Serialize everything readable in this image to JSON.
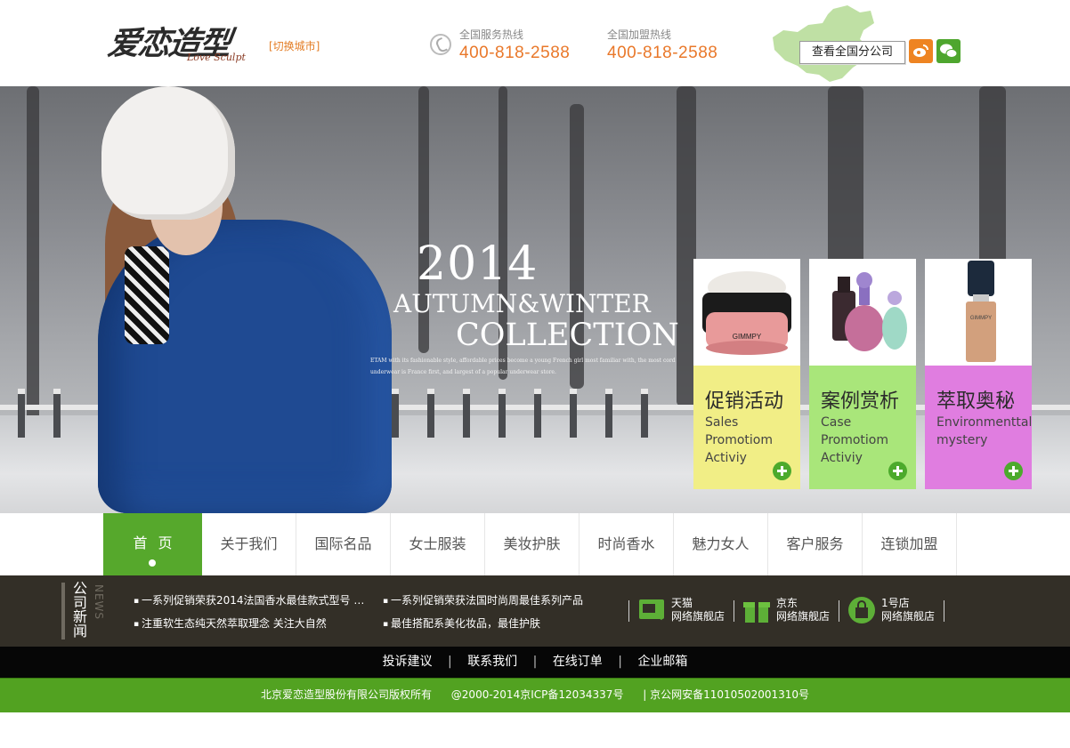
{
  "header": {
    "logo_cn": "爱恋造型",
    "logo_en": "Love Sculpt",
    "switch_city": "[切换城市]",
    "service_hotline": {
      "label": "全国服务热线",
      "number": "400-818-2588"
    },
    "join_hotline": {
      "label": "全国加盟热线",
      "number": "400-818-2588"
    },
    "branches_button": "查看全国分公司",
    "icons": {
      "phone": "phone-icon",
      "weibo": "weibo-icon",
      "wechat": "wechat-icon",
      "map": "china-map-icon"
    }
  },
  "banner": {
    "year": "2014",
    "line1": "AUTUMN&WINTER",
    "line2": "COLLECTION",
    "desc": "ETAM with its fashionable style, affordable prices become a young French girl most familiar with, the most cord underwear is France first, and largest of a popular underwear store.",
    "cards": [
      {
        "cn": "促销活动",
        "en": "Sales\nPromotiom\nActiviy",
        "color": "#f1ee86"
      },
      {
        "cn": "案例赏析",
        "en": "Case\nPromotiom\nActiviy",
        "color": "#a9e67a"
      },
      {
        "cn": "萃取奥秘",
        "en": "Environmenttal\nmystery",
        "color": "#e07de0"
      }
    ]
  },
  "nav": {
    "items": [
      "首页",
      "关于我们",
      "国际名品",
      "女士服装",
      "美妆护肤",
      "时尚香水",
      "魅力女人",
      "客户服务",
      "连锁加盟"
    ],
    "active_index": 0,
    "accent": "#56a82c"
  },
  "news": {
    "title": "公司新闻",
    "title_en": "NEWS",
    "items": [
      "一系列促销荣获2014法国香水最佳款式型号 …",
      "一系列促销荣获法国时尚周最佳系列产品",
      "注重软生态纯天然萃取理念 关注大自然",
      "最佳搭配系美化妆品，最佳护肤"
    ],
    "shops": [
      {
        "name": "天猫",
        "sub": "网络旗舰店",
        "icon": "tmall-icon"
      },
      {
        "name": "京东",
        "sub": "网络旗舰店",
        "icon": "jd-gift-icon"
      },
      {
        "name": "1号店",
        "sub": "网络旗舰店",
        "icon": "shopping-bag-icon"
      }
    ]
  },
  "footer": {
    "links": [
      "投诉建议",
      "联系我们",
      "在线订单",
      "企业邮箱"
    ],
    "copyright": "北京爱恋造型股份有限公司版权所有",
    "icp": "@2000-2014京ICP备12034337号",
    "police": "| 京公网安备11010502001310号"
  }
}
